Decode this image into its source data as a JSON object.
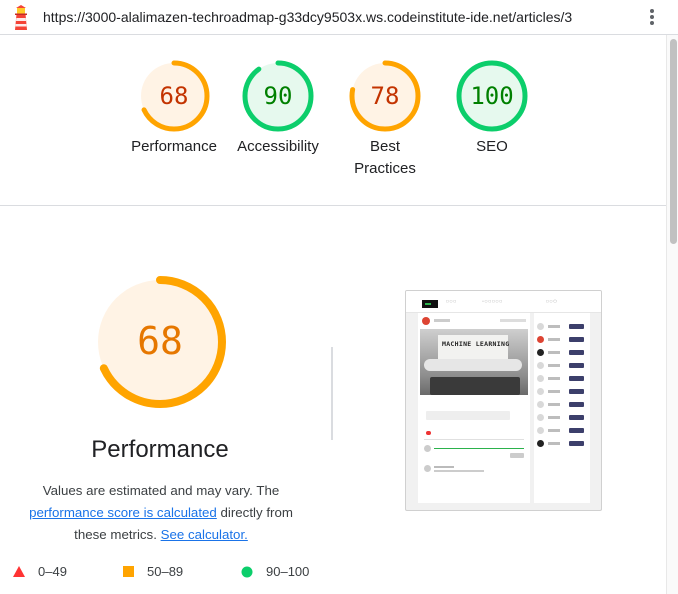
{
  "browser": {
    "url": "https://3000-alalimazen-techroadmap-g33dcy9503x.ws.codeinstitute-ide.net/articles/3",
    "logo_icon": "lighthouse-icon",
    "menu_icon": "kebab-menu-icon"
  },
  "gauges": [
    {
      "score": "68",
      "label": "Performance",
      "fraction": 0.68,
      "status": "average",
      "color": "#ffa400",
      "text_color": "#c33300",
      "bg": "#fff3e5"
    },
    {
      "score": "90",
      "label": "Accessibility",
      "fraction": 0.9,
      "status": "pass",
      "color": "#0cce6b",
      "text_color": "#008000",
      "bg": "#e6f9ee"
    },
    {
      "score": "78",
      "label": "Best Practices",
      "fraction": 0.78,
      "status": "average",
      "color": "#ffa400",
      "text_color": "#c33300",
      "bg": "#fff3e5"
    },
    {
      "score": "100",
      "label": "SEO",
      "fraction": 1.0,
      "status": "pass",
      "color": "#0cce6b",
      "text_color": "#008000",
      "bg": "#e6f9ee"
    }
  ],
  "performance": {
    "score": "68",
    "fraction": 0.68,
    "title": "Performance",
    "desc_start": "Values are estimated and may vary. The ",
    "link_text": "performance score is calculated",
    "desc_mid": " directly from these metrics. ",
    "calc_link": "See calculator.",
    "color": "#ffa400",
    "bg": "#fff3e5"
  },
  "legend": [
    {
      "range": "0–49",
      "icon": "red-triangle-icon",
      "color": "#ff3333"
    },
    {
      "range": "50–89",
      "icon": "orange-square-icon",
      "color": "#ffa400"
    },
    {
      "range": "90–100",
      "icon": "green-circle-icon",
      "color": "#0cce6b"
    }
  ],
  "screenshot": {
    "image_text": "MACHINE LEARNING"
  }
}
